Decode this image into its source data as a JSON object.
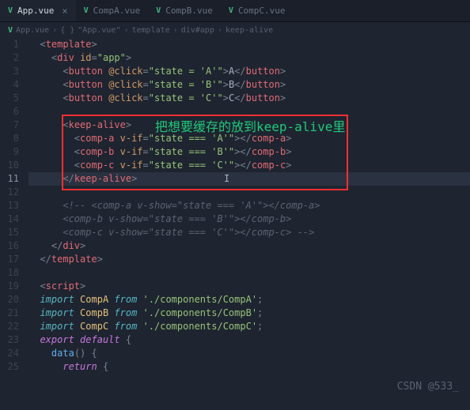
{
  "tabs": [
    {
      "icon": "V",
      "label": "App.vue",
      "active": true
    },
    {
      "icon": "V",
      "label": "CompA.vue",
      "active": false
    },
    {
      "icon": "V",
      "label": "CompB.vue",
      "active": false
    },
    {
      "icon": "V",
      "label": "CompC.vue",
      "active": false
    }
  ],
  "breadcrumb": [
    "App.vue",
    "{ }",
    "\"App.vue\"",
    "template",
    "div#app",
    "keep-alive"
  ],
  "annotation": "把想要缓存的放到keep-alive里",
  "watermark": "CSDN @533_",
  "code": {
    "l1": {
      "t1": "<",
      "tag": "template",
      "t2": ">"
    },
    "l2": {
      "t1": "<",
      "tag": "div",
      "sp": " ",
      "attr": "id",
      "eq": "=",
      "str": "\"app\"",
      "t2": ">"
    },
    "l3": {
      "t1": "<",
      "tag": "button",
      "sp": " ",
      "attr": "@click",
      "eq": "=",
      "str": "\"state = 'A'\"",
      "t2": ">",
      "txt": "A",
      "t3": "</",
      "tag2": "button",
      "t4": ">"
    },
    "l4": {
      "t1": "<",
      "tag": "button",
      "sp": " ",
      "attr": "@click",
      "eq": "=",
      "str": "\"state = 'B'\"",
      "t2": ">",
      "txt": "B",
      "t3": "</",
      "tag2": "button",
      "t4": ">"
    },
    "l5": {
      "t1": "<",
      "tag": "button",
      "sp": " ",
      "attr": "@click",
      "eq": "=",
      "str": "\"state = 'C'\"",
      "t2": ">",
      "txt": "C",
      "t3": "</",
      "tag2": "button",
      "t4": ">"
    },
    "l7": {
      "t1": "<",
      "tag": "keep-alive",
      "t2": ">"
    },
    "l8": {
      "t1": "<",
      "tag": "comp-a",
      "sp": " ",
      "attr": "v-if",
      "eq": "=",
      "str": "\"state === 'A'\"",
      "t2": "></",
      "tag2": "comp-a",
      "t3": ">"
    },
    "l9": {
      "t1": "<",
      "tag": "comp-b",
      "sp": " ",
      "attr": "v-if",
      "eq": "=",
      "str": "\"state === 'B'\"",
      "t2": "></",
      "tag2": "comp-b",
      "t3": ">"
    },
    "l10": {
      "t1": "<",
      "tag": "comp-c",
      "sp": " ",
      "attr": "v-if",
      "eq": "=",
      "str": "\"state === 'C'\"",
      "t2": "></",
      "tag2": "comp-c",
      "t3": ">"
    },
    "l11": {
      "t1": "</",
      "tag": "keep-alive",
      "t2": ">"
    },
    "l13": "<!-- <comp-a v-show=\"state === 'A'\"></comp-a>",
    "l14": "<comp-b v-show=\"state === 'B'\"></comp-b>",
    "l15": "<comp-c v-show=\"state === 'C'\"></comp-c> -->",
    "l16": {
      "t1": "</",
      "tag": "div",
      "t2": ">"
    },
    "l17": {
      "t1": "</",
      "tag": "template",
      "t2": ">"
    },
    "l19": {
      "t1": "<",
      "tag": "script",
      "t2": ">"
    },
    "l20": {
      "kw": "import",
      "sp": " ",
      "var": "CompA",
      "sp2": " ",
      "fr": "from",
      "sp3": " ",
      "str": "'./components/CompA'",
      "sc": ";"
    },
    "l21": {
      "kw": "import",
      "sp": " ",
      "var": "CompB",
      "sp2": " ",
      "fr": "from",
      "sp3": " ",
      "str": "'./components/CompB'",
      "sc": ";"
    },
    "l22": {
      "kw": "import",
      "sp": " ",
      "var": "CompC",
      "sp2": " ",
      "fr": "from",
      "sp3": " ",
      "str": "'./components/CompC'",
      "sc": ";"
    },
    "l23": {
      "kw": "export",
      "sp": " ",
      "kw2": "default",
      "sp2": " ",
      "br": "{"
    },
    "l24": {
      "fn": "data",
      "par": "()",
      "sp": " ",
      "br": "{"
    },
    "l25": {
      "kw": "return",
      "sp": " ",
      "br": "{"
    }
  }
}
